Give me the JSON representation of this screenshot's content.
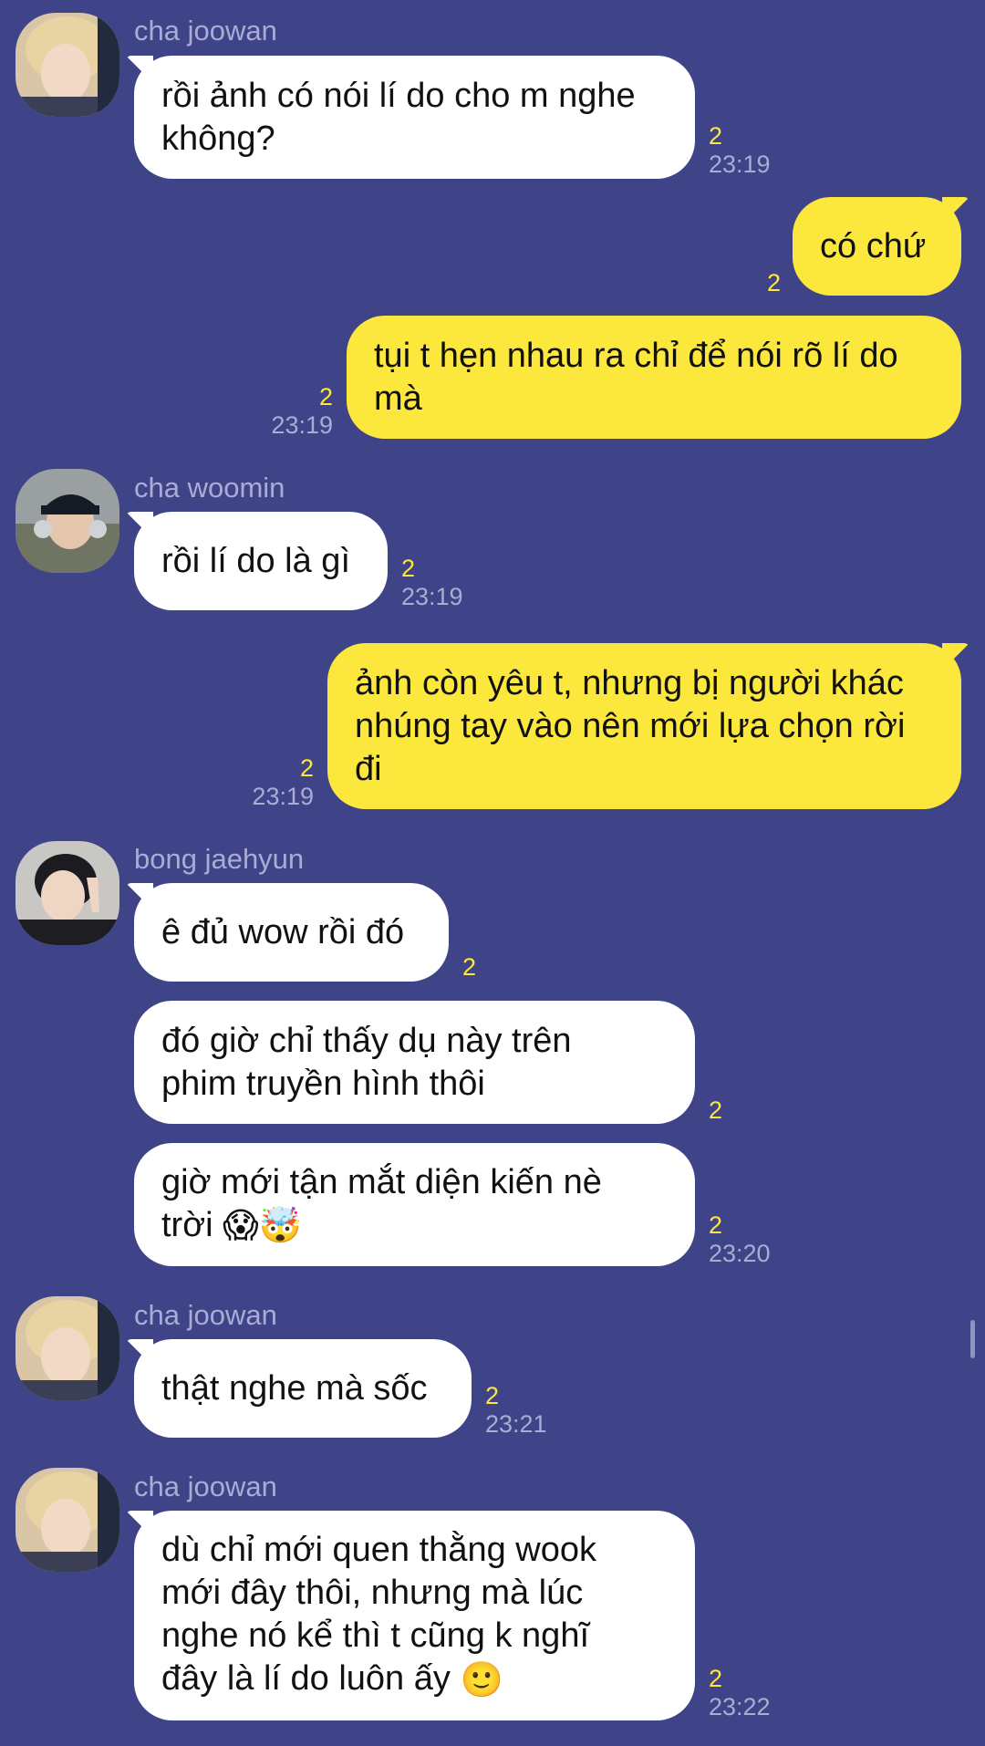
{
  "messages": [
    {
      "sender": "cha joowan",
      "text": "rồi ảnh có nói lí do cho m nghe\nkhông?",
      "count": "2",
      "time": "23:19"
    },
    {
      "text": "có chứ",
      "count": "2"
    },
    {
      "text": "tụi t hẹn nhau ra chỉ để nói rõ lí do\nmà",
      "count": "2",
      "time": "23:19"
    },
    {
      "sender": "cha woomin",
      "text": "rồi lí do là gì",
      "count": "2",
      "time": "23:19"
    },
    {
      "text": "ảnh còn yêu t, nhưng bị người khác\nnhúng tay vào nên mới lựa chọn rời\nđi",
      "count": "2",
      "time": "23:19"
    },
    {
      "sender": "bong jaehyun",
      "text": "ê đủ wow rồi đó",
      "count": "2"
    },
    {
      "text": "đó giờ chỉ thấy dụ này trên\nphim truyền hình thôi",
      "count": "2"
    },
    {
      "text": "giờ mới tận mắt diện kiến nè\ntrời",
      "emoji": "😱🤯",
      "count": "2",
      "time": "23:20"
    },
    {
      "sender": "cha joowan",
      "text": "thật nghe mà sốc",
      "count": "2",
      "time": "23:21"
    },
    {
      "sender": "cha joowan",
      "text": "dù chỉ mới quen thằng wook\nmới đây thôi, nhưng mà lúc\nnghe nó kể thì t cũng k nghĩ\nđây là lí do luôn ấy",
      "emoji": "🙂",
      "count": "2",
      "time": "23:22"
    }
  ]
}
